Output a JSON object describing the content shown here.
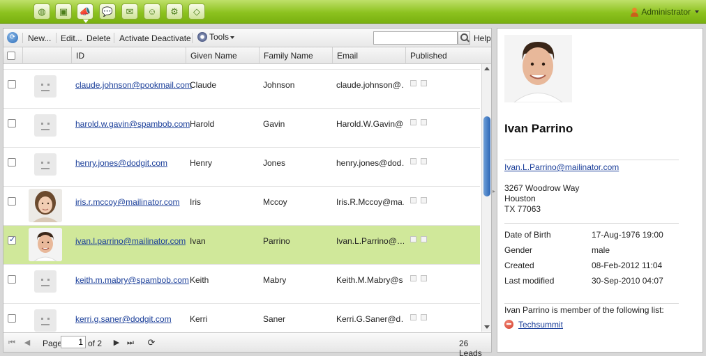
{
  "topbar": {
    "icons": [
      "globe-icon",
      "camera-icon",
      "campaign-icon",
      "chat-icon",
      "mail-icon",
      "users-icon",
      "settings-icon",
      "tag-icon"
    ],
    "active_icon": "campaign-icon",
    "user_label": "Administrator"
  },
  "toolbar": {
    "new_label": "New...",
    "edit_label": "Edit...",
    "delete_label": "Delete",
    "activate_label": "Activate",
    "deactivate_label": "Deactivate",
    "tools_label": "Tools",
    "search_placeholder": "",
    "help_label": "Help"
  },
  "columns": {
    "id": "ID",
    "given": "Given Name",
    "family": "Family Name",
    "email": "Email",
    "published": "Published"
  },
  "rows": [
    {
      "id": "claude.johnson@pookmail.com",
      "given": "Claude",
      "family": "Johnson",
      "email": "claude.johnson@…",
      "avatar": "placeholder",
      "checked": false
    },
    {
      "id": "harold.w.gavin@spambob.com",
      "given": "Harold",
      "family": "Gavin",
      "email": "Harold.W.Gavin@…",
      "avatar": "placeholder",
      "checked": false
    },
    {
      "id": "henry.jones@dodgit.com",
      "given": "Henry",
      "family": "Jones",
      "email": "henry.jones@dod…",
      "avatar": "placeholder",
      "checked": false
    },
    {
      "id": "iris.r.mccoy@mailinator.com",
      "given": "Iris",
      "family": "Mccoy",
      "email": "Iris.R.Mccoy@ma…",
      "avatar": "photo-female",
      "checked": false
    },
    {
      "id": "ivan.l.parrino@mailinator.com",
      "given": "Ivan",
      "family": "Parrino",
      "email": "Ivan.L.Parrino@…",
      "avatar": "photo-male",
      "checked": true
    },
    {
      "id": "keith.m.mabry@spambob.com",
      "given": "Keith",
      "family": "Mabry",
      "email": "Keith.M.Mabry@s…",
      "avatar": "placeholder",
      "checked": false
    },
    {
      "id": "kerri.g.saner@dodgit.com",
      "given": "Kerri",
      "family": "Saner",
      "email": "Kerri.G.Saner@d…",
      "avatar": "placeholder",
      "checked": false
    }
  ],
  "pager": {
    "page_label": "Page",
    "page_value": "1",
    "of_label": "of 2",
    "count_label": "26 Leads"
  },
  "detail": {
    "name": "Ivan Parrino",
    "email": "Ivan.L.Parrino@mailinator.com",
    "address": {
      "street": "3267 Woodrow Way",
      "city": "Houston",
      "state_zip": "TX 77063"
    },
    "fields": [
      {
        "label": "Date of Birth",
        "value": "17-Aug-1976 19:00"
      },
      {
        "label": "Gender",
        "value": "male"
      },
      {
        "label": "Created",
        "value": "08-Feb-2012 11:04"
      },
      {
        "label": "Last modified",
        "value": "30-Sep-2010 04:07"
      }
    ],
    "lists_text": "Ivan Parrino is member of the following list:",
    "list_name": "Techsummit"
  },
  "colors": {
    "accent_green": "#8cc21f",
    "selected_row": "#d0e89a",
    "link": "#1b3f9a"
  }
}
